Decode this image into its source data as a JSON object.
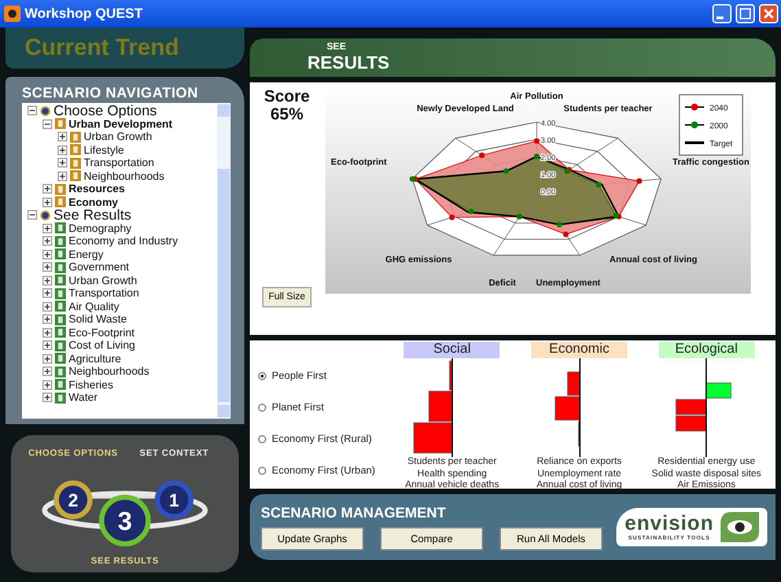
{
  "window": {
    "title": "Workshop QUEST"
  },
  "header": {
    "title": "Current Trend"
  },
  "navigation": {
    "title": "SCENARIO NAVIGATION",
    "tree": [
      {
        "label": "Choose Options",
        "expanded": true,
        "children": [
          {
            "label": "Urban Development",
            "expanded": true,
            "children": [
              {
                "label": "Urban Growth",
                "expanded": false
              },
              {
                "label": "Lifestyle",
                "expanded": false
              },
              {
                "label": "Transportation",
                "expanded": false
              },
              {
                "label": "Neighbourhoods",
                "expanded": false
              }
            ]
          },
          {
            "label": "Resources",
            "expanded": false
          },
          {
            "label": "Economy",
            "expanded": false
          }
        ]
      },
      {
        "label": "See Results",
        "expanded": true,
        "children": [
          {
            "label": "Demography",
            "expanded": false
          },
          {
            "label": "Economy and Industry",
            "expanded": false
          },
          {
            "label": "Energy",
            "expanded": false
          },
          {
            "label": "Government",
            "expanded": false
          },
          {
            "label": "Urban Growth",
            "expanded": false
          },
          {
            "label": "Transportation",
            "expanded": false
          },
          {
            "label": "Air Quality",
            "expanded": false
          },
          {
            "label": "Solid Waste",
            "expanded": false
          },
          {
            "label": "Eco-Footprint",
            "expanded": false
          },
          {
            "label": "Cost of Living",
            "expanded": false
          },
          {
            "label": "Agriculture",
            "expanded": false
          },
          {
            "label": "Neighbourhoods",
            "expanded": false
          },
          {
            "label": "Fisheries",
            "expanded": false
          },
          {
            "label": "Water",
            "expanded": false
          }
        ]
      }
    ]
  },
  "steps": [
    {
      "number": "2",
      "label": "CHOOSE OPTIONS",
      "color": "#c8a83a"
    },
    {
      "number": "1",
      "label": "SET CONTEXT",
      "color": "#3050c0"
    },
    {
      "number": "3",
      "label": "SEE RESULTS",
      "color": "#6cc030"
    }
  ],
  "results": {
    "kicker": "SEE",
    "title": "RESULTS",
    "score_label": "Score",
    "score": "65%",
    "full_size_button": "Full Size",
    "radar": {
      "axis_labels": [
        "Air Pollution",
        "Newly Developed Land",
        "Students per teacher",
        "Eco-footprint",
        "Traffic congestion",
        "GHG emissions",
        "Annual cost of living",
        "Deficit",
        "Unemployment"
      ],
      "tick_labels": [
        "4.00",
        "3.00",
        "2.00",
        "1.00",
        "0.00"
      ],
      "legend": [
        {
          "name": "2040",
          "color": "#dd0000",
          "kind": "marker"
        },
        {
          "name": "2000",
          "color": "#008000",
          "kind": "marker"
        },
        {
          "name": "Target",
          "color": "#000000",
          "kind": "line"
        }
      ]
    }
  },
  "scenarios": {
    "options": [
      {
        "label": "People First",
        "selected": true
      },
      {
        "label": "Planet First",
        "selected": false
      },
      {
        "label": "Economy First (Rural)",
        "selected": false
      },
      {
        "label": "Economy First (Urban)",
        "selected": false
      }
    ],
    "indicators": [
      {
        "title": "Social",
        "color": "#c8c8f8",
        "labels": [
          "Students per teacher",
          "Health spending",
          "Annual vehicle deaths"
        ]
      },
      {
        "title": "Economic",
        "color": "#fde0c0",
        "labels": [
          "Reliance on exports",
          "Unemployment rate",
          "Annual cost of living"
        ]
      },
      {
        "title": "Ecological",
        "color": "#c4fcc4",
        "labels": [
          "Residential energy use",
          "Solid waste disposal sites",
          "Air Emissions"
        ]
      }
    ]
  },
  "management": {
    "title": "SCENARIO MANAGEMENT",
    "buttons": [
      "Update Graphs",
      "Compare",
      "Run All Models"
    ]
  },
  "logo": {
    "name": "envision",
    "tagline": "SUSTAINABILITY TOOLS"
  }
}
